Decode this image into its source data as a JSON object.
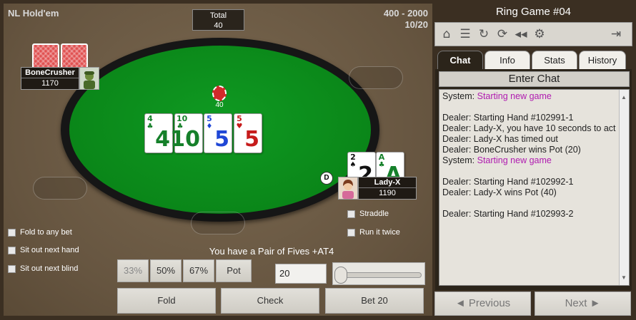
{
  "table": {
    "game_name": "NL Hold'em",
    "blinds": "400 - 2000",
    "seats": "10/20",
    "total_label": "Total",
    "total_value": "40",
    "pot": "40",
    "status_text": "You have a Pair of Fives +AT4"
  },
  "board": [
    {
      "rank": "4",
      "suit": "♣",
      "color": "#15802a"
    },
    {
      "rank": "10",
      "suit": "♣",
      "color": "#15802a"
    },
    {
      "rank": "5",
      "suit": "♦",
      "color": "#1f47d6"
    },
    {
      "rank": "5",
      "suit": "♥",
      "color": "#c61b1b"
    }
  ],
  "players": {
    "opponent": {
      "name": "BoneCrusher",
      "chips": "1170"
    },
    "hero": {
      "name": "Lady-X",
      "chips": "1190",
      "dealer_label": "D",
      "cards": [
        {
          "rank": "2",
          "suit": "♠"
        },
        {
          "rank": "A",
          "suit": "♣"
        }
      ]
    }
  },
  "options_left": [
    "Fold to any bet",
    "Sit out next hand",
    "Sit out next blind"
  ],
  "options_right": [
    "Straddle",
    "Run it twice"
  ],
  "bet_presets": [
    "33%",
    "50%",
    "67%",
    "Pot"
  ],
  "bet_amount": "20",
  "actions": {
    "fold": "Fold",
    "check": "Check",
    "bet": "Bet 20"
  },
  "side": {
    "title": "Ring Game #04",
    "tabs": [
      "Chat",
      "Info",
      "Stats",
      "History"
    ],
    "enter_chat": "Enter Chat",
    "chat": [
      {
        "who": "System: ",
        "text": "Starting new game",
        "sys": true
      },
      {
        "who": "",
        "text": "",
        "sys": false
      },
      {
        "who": "Dealer: ",
        "text": "Starting Hand #102991-1",
        "sys": false
      },
      {
        "who": "Dealer: ",
        "text": "Lady-X, you have 10 seconds to act",
        "sys": false
      },
      {
        "who": "Dealer: ",
        "text": "Lady-X has timed out",
        "sys": false
      },
      {
        "who": "Dealer: ",
        "text": "BoneCrusher wins Pot (20)",
        "sys": false
      },
      {
        "who": "System: ",
        "text": "Starting new game",
        "sys": true
      },
      {
        "who": "",
        "text": "",
        "sys": false
      },
      {
        "who": "Dealer: ",
        "text": "Starting Hand #102992-1",
        "sys": false
      },
      {
        "who": "Dealer: ",
        "text": "Lady-X wins Pot (40)",
        "sys": false
      },
      {
        "who": "",
        "text": "",
        "sys": false
      },
      {
        "who": "Dealer: ",
        "text": "Starting Hand #102993-2",
        "sys": false
      }
    ],
    "previous": "◄ Previous",
    "next": "Next ►"
  }
}
